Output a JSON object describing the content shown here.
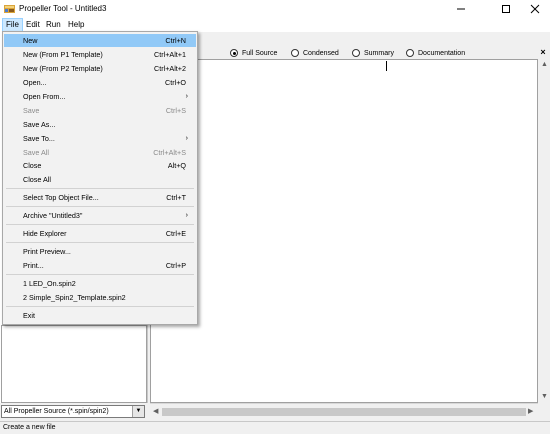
{
  "window": {
    "title": "Propeller Tool - Untitled3",
    "minimize_icon": "minimize-icon",
    "maximize_icon": "maximize-icon",
    "close_icon": "close-icon"
  },
  "menubar": [
    {
      "label": "File"
    },
    {
      "label": "Edit"
    },
    {
      "label": "Run"
    },
    {
      "label": "Help"
    }
  ],
  "view_modes": [
    {
      "label": "Full Source",
      "checked": true
    },
    {
      "label": "Condensed",
      "checked": false
    },
    {
      "label": "Summary",
      "checked": false
    },
    {
      "label": "Documentation",
      "checked": false
    }
  ],
  "editor_close": "×",
  "file_menu": [
    {
      "label": "New",
      "shortcut": "Ctrl+N",
      "enabled": true,
      "highlighted": true
    },
    {
      "label": "New (From P1 Template)",
      "shortcut": "Ctrl+Alt+1",
      "enabled": true
    },
    {
      "label": "New (From P2 Template)",
      "shortcut": "Ctrl+Alt+2",
      "enabled": true
    },
    {
      "label": "Open...",
      "shortcut": "Ctrl+O",
      "enabled": true
    },
    {
      "label": "Open From...",
      "shortcut": "",
      "submenu": true,
      "enabled": true
    },
    {
      "label": "Save",
      "shortcut": "Ctrl+S",
      "enabled": false
    },
    {
      "label": "Save As...",
      "shortcut": "",
      "enabled": true
    },
    {
      "label": "Save To...",
      "shortcut": "",
      "submenu": true,
      "enabled": true
    },
    {
      "label": "Save All",
      "shortcut": "Ctrl+Alt+S",
      "enabled": false
    },
    {
      "label": "Close",
      "shortcut": "Alt+Q",
      "enabled": true
    },
    {
      "label": "Close All",
      "shortcut": "",
      "enabled": true
    },
    {
      "label": "Select Top Object File...",
      "shortcut": "Ctrl+T",
      "enabled": true
    },
    {
      "label": "Archive \"Untitled3\"",
      "shortcut": "",
      "submenu": true,
      "enabled": true
    },
    {
      "label": "Hide Explorer",
      "shortcut": "Ctrl+E",
      "enabled": true
    },
    {
      "label": "Print Preview...",
      "shortcut": "",
      "enabled": true
    },
    {
      "label": "Print...",
      "shortcut": "Ctrl+P",
      "enabled": true
    },
    {
      "label": "1  LED_On.spin2",
      "shortcut": "",
      "enabled": true
    },
    {
      "label": "2  Simple_Spin2_Template.spin2",
      "shortcut": "",
      "enabled": true
    },
    {
      "label": "Exit",
      "shortcut": "",
      "enabled": true
    }
  ],
  "file_filter": "All Propeller Source (*.spin/spin2)",
  "status_text": "Create a new file",
  "colors": {
    "menu_highlight": "#91c9f7",
    "menubar_active": "#cce8ff"
  }
}
